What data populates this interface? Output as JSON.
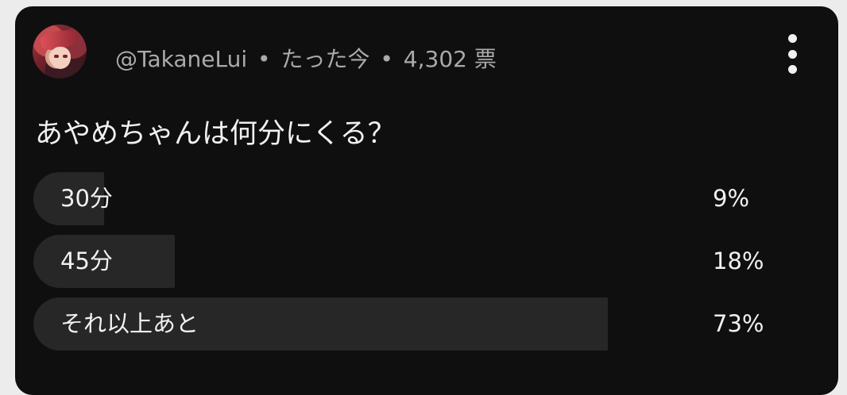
{
  "post": {
    "author": "@TakaneLui",
    "separator": "•",
    "time": "たった今",
    "votes": "4,302 票",
    "question": "あやめちゃんは何分にくる？"
  },
  "icons": {
    "menu": "more-vert-icon",
    "avatar": "user-avatar"
  },
  "colors": {
    "background": "#0f0f0f",
    "bar": "#272727",
    "text": "#f1f1f1",
    "meta_text": "#aaaaaa"
  },
  "options": [
    {
      "label": "30分",
      "percent_text": "9%",
      "percent": 9
    },
    {
      "label": "45分",
      "percent_text": "18%",
      "percent": 18
    },
    {
      "label": "それ以上あと",
      "percent_text": "73%",
      "percent": 73
    }
  ]
}
